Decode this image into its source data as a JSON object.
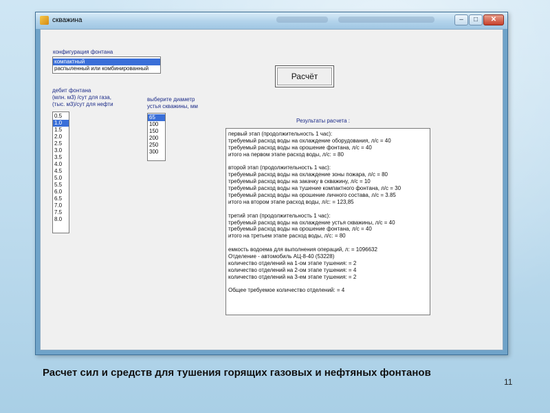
{
  "window": {
    "title": "скважина"
  },
  "config": {
    "label": "конфигурация фонтана",
    "options": [
      {
        "label": "компактный",
        "selected": true
      },
      {
        "label": "распыленный или комбинированный",
        "selected": false
      }
    ]
  },
  "calc_button": {
    "label": "Расчёт"
  },
  "debit": {
    "label_lines": [
      "дебит фонтана",
      "(млн. м3) /сут для газа,",
      "(тыс. м3)/сут для нефти"
    ],
    "options": [
      "0.5",
      "1.0",
      "1.5",
      "2.0",
      "2.5",
      "3.0",
      "3.5",
      "4.0",
      "4.5",
      "5.0",
      "5.5",
      "6.0",
      "6.5",
      "7.0",
      "7.5",
      "8.0"
    ],
    "selected": "1.0"
  },
  "diameter": {
    "label_lines": [
      "выберите диаметр",
      "устья скважины, мм"
    ],
    "options": [
      "65",
      "100",
      "150",
      "200",
      "250",
      "300"
    ],
    "selected": "65"
  },
  "results": {
    "label": "Результаты расчета :",
    "lines": [
      "первый этап (продолжительность 1 час):",
      "требуемый расход воды на охлаждение оборудования, л/с = 40",
      "требуемый расход воды на орошение фонтана, л/с = 40",
      "итого на первом этапе расход воды, л/с: = 80",
      "",
      "второй этап (продолжительность 1 час):",
      "требуемый расход воды на охлаждение зоны пожара, л/с = 80",
      "требуемый расход воды на закачку в скважину, л/с = 10",
      "требуемый расход воды на тушение компактного фонтана, л/с = 30",
      "требуемый расход воды на орошение личного состава, л/с = 3.85",
      "итого на втором этапе расход воды, л/с: = 123,85",
      "",
      "третий этап (продолжительность 1 час):",
      "требуемый расход воды на охлаждение устья скважины, л/с = 40",
      "требуемый расход воды на орошение фонтана, л/с = 40",
      "итого на третьем этапе расход воды, л/с: = 80",
      "",
      "емкость водоема для выполнения операций, л: = 1096632",
      "Отделение - автомобиль АЦ-8-40 (53228)",
      "количество отделений на 1-ом этапе тушения: = 2",
      "количество отделений на 2-ом этапе тушения: = 4",
      "количество отделений на 3-ем этапе тушения: = 2",
      "",
      "Общее требуемое количество отделений: = 4"
    ]
  },
  "slide": {
    "caption": "Расчет сил и средств для тушения горящих газовых и нефтяных фонтанов",
    "page_number": "11"
  },
  "colors": {
    "selection": "#3a6fd8",
    "label_text": "#1a2a88"
  }
}
